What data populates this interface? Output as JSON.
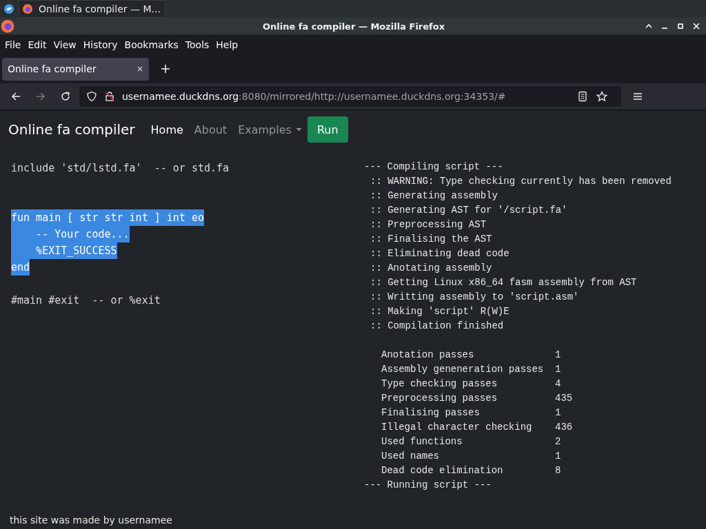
{
  "taskbar": {
    "window_button": {
      "title": "Online fa compiler — M..."
    }
  },
  "window": {
    "title": "Online fa compiler — Mozilla Firefox"
  },
  "menu_bar": [
    "File",
    "Edit",
    "View",
    "History",
    "Bookmarks",
    "Tools",
    "Help"
  ],
  "tabs": [
    {
      "label": "Online fa compiler",
      "selected": true
    }
  ],
  "address_bar": {
    "host": "usernamee.duckdns.org",
    "rest": ":8080/mirrored/http://usernamee.duckdns.org:34353/#"
  },
  "navbar": {
    "brand": "Online fa compiler",
    "links": [
      {
        "label": "Home",
        "selected": true,
        "kind": "link"
      },
      {
        "label": "About",
        "selected": false,
        "kind": "link"
      },
      {
        "label": "Examples",
        "selected": false,
        "kind": "dropdown"
      }
    ],
    "run_button": "Run"
  },
  "editor": {
    "lines": [
      {
        "kind": "code",
        "text": "include 'std/lstd.fa'  -- or std.fa",
        "selected": false
      },
      {
        "kind": "blank"
      },
      {
        "kind": "blank"
      },
      {
        "kind": "code",
        "text": "fun main [ str str int ] int eo",
        "selected": true
      },
      {
        "kind": "code",
        "text": "    -- Your code...",
        "selected": true
      },
      {
        "kind": "code",
        "text": "    %EXIT_SUCCESS",
        "selected": true
      },
      {
        "kind": "code",
        "text": "end",
        "selected": true
      },
      {
        "kind": "blank"
      },
      {
        "kind": "code",
        "text": "#main #exit  -- or %exit",
        "selected": false
      }
    ]
  },
  "output": {
    "header": "--- Compiling script ---",
    "steps": [
      ":: WARNING: Type checking currently has been removed",
      ":: Generating assembly",
      ":: Generating AST for '/script.fa'",
      ":: Preprocessing AST",
      ":: Finalising the AST",
      ":: Eliminating dead code",
      ":: Anotating assembly",
      ":: Getting Linux x86_64 fasm assembly from AST",
      ":: Writting assembly to 'script.asm'",
      ":: Making 'script' R(W)E",
      ":: Compilation finished"
    ],
    "stats": [
      {
        "label": "Anotation passes",
        "value": "1"
      },
      {
        "label": "Assembly geneneration passes",
        "value": "1"
      },
      {
        "label": "Type checking passes",
        "value": "4"
      },
      {
        "label": "Preprocessing passes",
        "value": "435"
      },
      {
        "label": "Finalising passes",
        "value": "1"
      },
      {
        "label": "Illegal character checking",
        "value": "436"
      },
      {
        "label": "Used functions",
        "value": "2"
      },
      {
        "label": "Used names",
        "value": "1"
      },
      {
        "label": "Dead code elimination",
        "value": "8"
      }
    ],
    "footer": "--- Running script ---"
  },
  "footer": "this site was made by usernamee"
}
